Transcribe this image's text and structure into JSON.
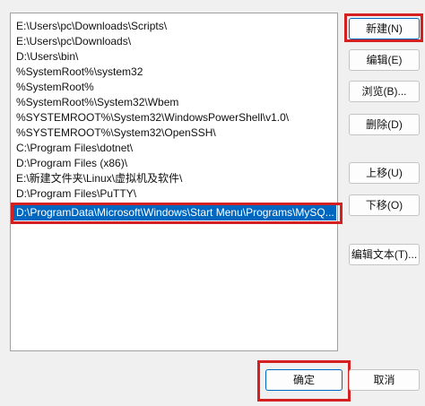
{
  "path_list": {
    "items": [
      {
        "text": "E:\\Users\\pc\\Downloads\\Scripts\\"
      },
      {
        "text": "E:\\Users\\pc\\Downloads\\"
      },
      {
        "text": "D:\\Users\\bin\\"
      },
      {
        "text": "%SystemRoot%\\system32"
      },
      {
        "text": "%SystemRoot%"
      },
      {
        "text": "%SystemRoot%\\System32\\Wbem"
      },
      {
        "text": "%SYSTEMROOT%\\System32\\WindowsPowerShell\\v1.0\\"
      },
      {
        "text": "%SYSTEMROOT%\\System32\\OpenSSH\\"
      },
      {
        "text": "C:\\Program Files\\dotnet\\"
      },
      {
        "text": "D:\\Program Files (x86)\\"
      },
      {
        "text": "E:\\新建文件夹\\Linux\\虚拟机及软件\\"
      },
      {
        "text": "D:\\Program Files\\PuTTY\\"
      },
      {
        "text": "D:\\ProgramData\\Microsoft\\Windows\\Start Menu\\Programs\\MySQ..."
      }
    ],
    "selected_index": 12
  },
  "buttons": {
    "new": "新建(N)",
    "edit": "编辑(E)",
    "browse": "浏览(B)...",
    "delete": "删除(D)",
    "move_up": "上移(U)",
    "move_down": "下移(O)",
    "edit_text": "编辑文本(T)...",
    "ok": "确定",
    "cancel": "取消"
  },
  "colors": {
    "selection": "#0067c0",
    "highlight_annotation": "#d42020"
  }
}
